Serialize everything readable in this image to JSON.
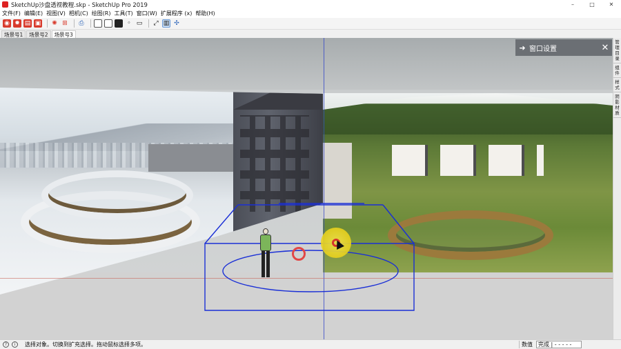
{
  "window": {
    "title": "SketchUp沙盘透视教程.skp - SketchUp Pro 2019",
    "minimize": "–",
    "maximize": "□",
    "close": "✕"
  },
  "menu": [
    "文件(F)",
    "编辑(E)",
    "视图(V)",
    "相机(C)",
    "绘图(R)",
    "工具(T)",
    "窗口(W)",
    "扩展程序 (x)",
    "帮助(H)"
  ],
  "scene_tabs": [
    "场景号1",
    "场景号2",
    "场景号3"
  ],
  "active_scene": 2,
  "tray": {
    "title": "窗口设置",
    "arrow": "➜",
    "close": "✕"
  },
  "side_tabs": [
    "管理目录",
    "组件",
    "样式",
    "阴影材质"
  ],
  "status": {
    "message": "选择对象。切换到扩充选择。拖动鼠标选择多项。",
    "measure_label": "数值",
    "measure_value": "完成 | - - - - -"
  },
  "colors": {
    "accent": "#3447c8",
    "selection_box": "#1a2fd6",
    "tray_header": "#6b6f74",
    "highlight": "#e9d11c"
  },
  "icons": {
    "app": "sketchup-logo-icon",
    "tray_arrow": "arrow-right-icon",
    "tray_close": "close-icon",
    "status_info": "info-icon"
  }
}
